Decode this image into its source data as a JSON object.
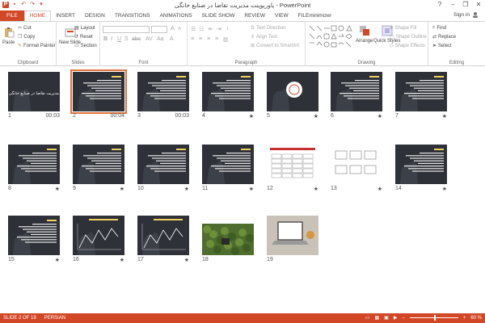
{
  "title": "پاورپوینت مدیریت تقاضا در صنایع خانگی - PowerPoint",
  "window_controls": [
    "?",
    "–",
    "❐",
    "✕"
  ],
  "qat": [
    "P",
    "💾",
    "↶",
    "↷",
    "▾"
  ],
  "tabs": [
    "FILE",
    "HOME",
    "INSERT",
    "DESIGN",
    "TRANSITIONS",
    "ANIMATIONS",
    "SLIDE SHOW",
    "REVIEW",
    "VIEW",
    "FILEminimizer"
  ],
  "active_tab": "HOME",
  "signin": "Sign in",
  "clipboard": {
    "paste": "Paste",
    "cut": "Cut",
    "copy": "Copy",
    "format_painter": "Format Painter",
    "label": "Clipboard"
  },
  "slides_group": {
    "new_slide": "New Slide",
    "layout": "Layout",
    "reset": "Reset",
    "section": "Section",
    "label": "Slides"
  },
  "font_group": {
    "label": "Font"
  },
  "paragraph_group": {
    "text_direction": "Text Direction",
    "align_text": "Align Text",
    "convert_smartart": "Convert to SmartArt",
    "label": "Paragraph"
  },
  "drawing_group": {
    "arrange": "Arrange",
    "quick_styles": "Quick Styles",
    "shape_fill": "Shape Fill",
    "shape_outline": "Shape Outline",
    "shape_effects": "Shape Effects",
    "label": "Drawing"
  },
  "editing_group": {
    "find": "Find",
    "replace": "Replace",
    "select": "Select",
    "label": "Editing"
  },
  "slides": [
    {
      "num": "1",
      "meta": "00:03",
      "title": "مدیریت تقاضا در صنایع خانگی",
      "kind": "title"
    },
    {
      "num": "2",
      "meta": "00:04",
      "kind": "text",
      "selected": true
    },
    {
      "num": "3",
      "meta": "00:03",
      "kind": "text"
    },
    {
      "num": "4",
      "meta": "★",
      "kind": "text"
    },
    {
      "num": "5",
      "meta": "★",
      "kind": "circle"
    },
    {
      "num": "6",
      "meta": "★",
      "kind": "text"
    },
    {
      "num": "7",
      "meta": "★",
      "kind": "text"
    },
    {
      "num": "8",
      "meta": "★",
      "kind": "text"
    },
    {
      "num": "9",
      "meta": "★",
      "kind": "text"
    },
    {
      "num": "10",
      "meta": "★",
      "kind": "text"
    },
    {
      "num": "11",
      "meta": "★",
      "kind": "text"
    },
    {
      "num": "12",
      "meta": "★",
      "kind": "table"
    },
    {
      "num": "13",
      "meta": "★",
      "kind": "diagram"
    },
    {
      "num": "14",
      "meta": "★",
      "kind": "text"
    },
    {
      "num": "15",
      "meta": "★",
      "kind": "text"
    },
    {
      "num": "16",
      "meta": "★",
      "kind": "chart"
    },
    {
      "num": "17",
      "meta": "★",
      "kind": "chart"
    },
    {
      "num": "18",
      "meta": "",
      "kind": "photo-green"
    },
    {
      "num": "19",
      "meta": "",
      "kind": "photo-laptop"
    }
  ],
  "status": {
    "slide": "SLIDE 2 OF 19",
    "language": "PERSIAN",
    "zoom": "60 %",
    "zoom_level": 0.6
  },
  "colors": {
    "accent": "#d24726",
    "thumb_bg": "#2e3138",
    "selection": "#e3743b"
  }
}
